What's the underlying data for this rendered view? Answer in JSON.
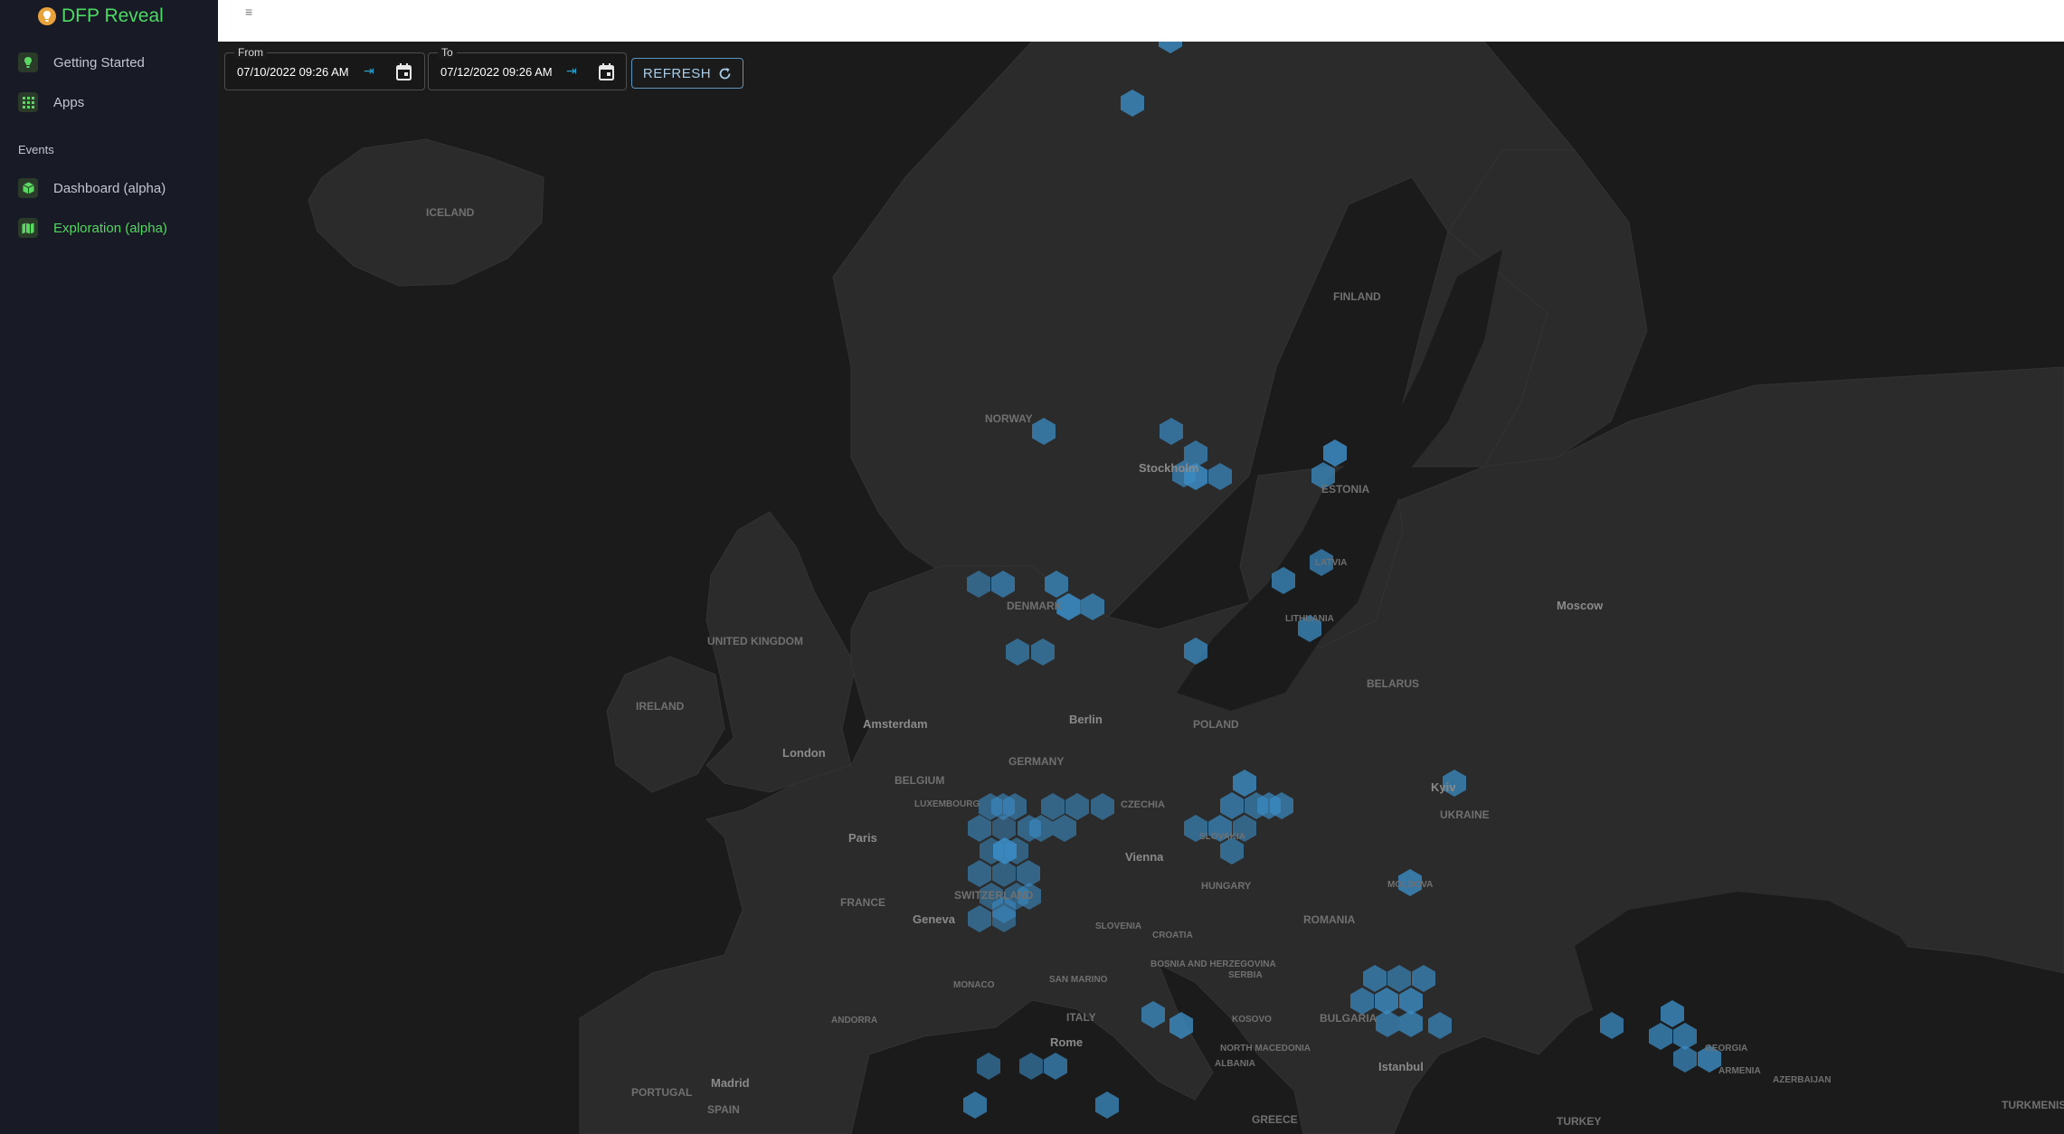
{
  "app": {
    "title": "DFP Reveal"
  },
  "sidebar": {
    "items": [
      {
        "label": "Getting Started",
        "icon": "lightbulb-icon"
      },
      {
        "label": "Apps",
        "icon": "grid-icon"
      }
    ],
    "section_title": "Events",
    "event_items": [
      {
        "label": "Dashboard (alpha)",
        "icon": "cube-icon"
      },
      {
        "label": "Exploration (alpha)",
        "icon": "map-icon",
        "active": true
      }
    ]
  },
  "topbar": {
    "menu_icon": "hamburger-icon"
  },
  "filters": {
    "from": {
      "label": "From",
      "value": "07/10/2022 09:26 AM"
    },
    "to": {
      "label": "To",
      "value": "07/12/2022 09:26 AM"
    },
    "refresh_label": "REFRESH"
  },
  "map": {
    "labels": {
      "countries": [
        "ICELAND",
        "NORWAY",
        "FINLAND",
        "ESTONIA",
        "LATVIA",
        "LITHUANIA",
        "DENMARK",
        "UNITED KINGDOM",
        "IRELAND",
        "BELARUS",
        "POLAND",
        "GERMANY",
        "BELGIUM",
        "LUXEMBOURG",
        "CZECHIA",
        "SLOVAKIA",
        "UKRAINE",
        "FRANCE",
        "SWITZERLAND",
        "HUNGARY",
        "MOLDOVA",
        "ROMANIA",
        "SLOVENIA",
        "CROATIA",
        "BOSNIA AND HERZEGOVINA",
        "SERBIA",
        "MONACO",
        "SAN MARINO",
        "ANDORRA",
        "ITALY",
        "KOSOVO",
        "BULGARIA",
        "NORTH MACEDONIA",
        "ALBANIA",
        "GEORGIA",
        "ARMENIA",
        "AZERBAIJAN",
        "PORTUGAL",
        "SPAIN",
        "GREECE",
        "TURKEY",
        "TURKMENIS"
      ],
      "cities": [
        "Stockholm",
        "Moscow",
        "Amsterdam",
        "Berlin",
        "London",
        "Paris",
        "Kyiv",
        "Vienna",
        "Geneva",
        "Rome",
        "Madrid",
        "Istanbul"
      ]
    },
    "colors": {
      "land": "#2b2b2b",
      "water": "#1b1b1b",
      "hex": "#3b8cc4"
    }
  }
}
